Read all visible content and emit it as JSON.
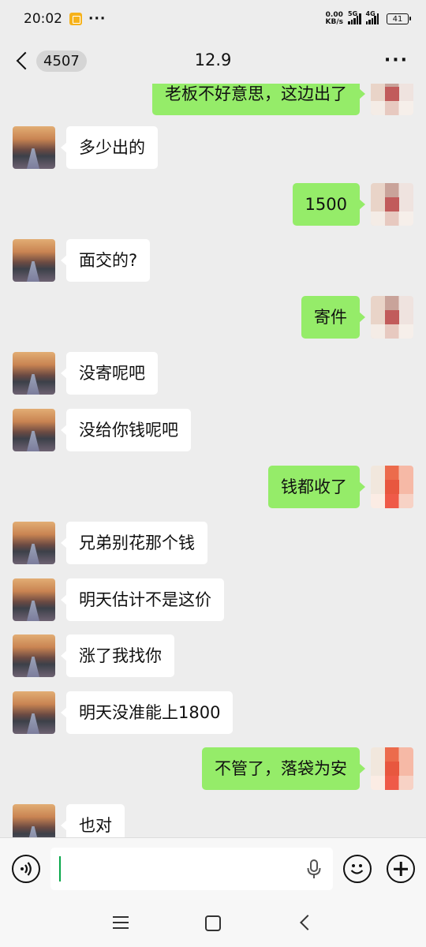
{
  "status_bar": {
    "time": "20:02",
    "net_speed_value": "0.00",
    "net_speed_unit": "KB/s",
    "signal1_label": "5G",
    "signal2_label": "4G",
    "battery": "41"
  },
  "header": {
    "unread_count": "4507",
    "title": "12.9",
    "more": "···"
  },
  "messages": [
    {
      "side": "right",
      "text": "老板不好意思，这边出了"
    },
    {
      "side": "left",
      "text": "多少出的"
    },
    {
      "side": "right",
      "text": "1500"
    },
    {
      "side": "left",
      "text": "面交的?"
    },
    {
      "side": "right",
      "text": "寄件"
    },
    {
      "side": "left",
      "text": "没寄呢吧"
    },
    {
      "side": "left",
      "text": "没给你钱呢吧"
    },
    {
      "side": "right",
      "text": "钱都收了"
    },
    {
      "side": "left",
      "text": "兄弟别花那个钱"
    },
    {
      "side": "left",
      "text": "明天估计不是这价"
    },
    {
      "side": "left",
      "text": "涨了我找你"
    },
    {
      "side": "left",
      "text": "明天没准能上1800"
    },
    {
      "side": "right",
      "text": "不管了，落袋为安"
    },
    {
      "side": "left",
      "text": "也对"
    }
  ],
  "colors": {
    "sent_bubble": "#95ec69",
    "received_bubble": "#ffffff",
    "background": "#ededed",
    "caret": "#08a74a"
  },
  "icons": {
    "voice": "voice-icon",
    "mic": "mic-icon",
    "emoji": "emoji-icon",
    "plus": "plus-icon"
  }
}
